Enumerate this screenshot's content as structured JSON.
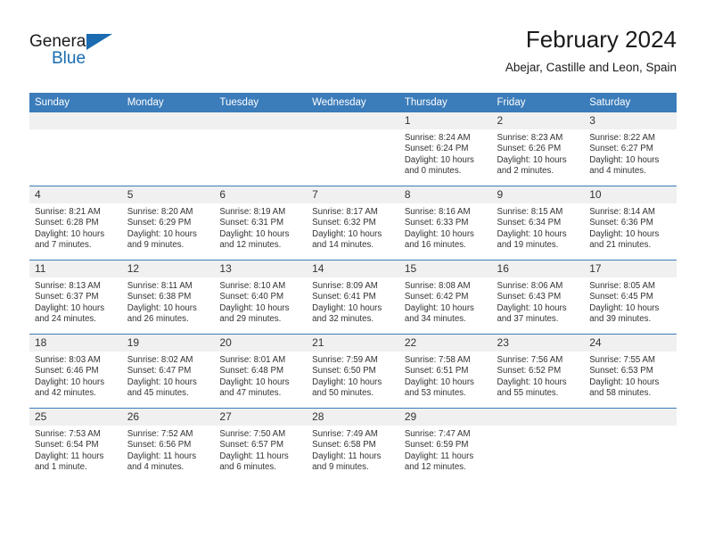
{
  "brand": {
    "name_part1": "General",
    "name_part2": "Blue",
    "triangle_color": "#1a6bb0"
  },
  "header": {
    "title": "February 2024",
    "subtitle": "Abejar, Castille and Leon, Spain"
  },
  "theme": {
    "header_blue": "#3b7cba",
    "daynum_gray": "#f0f0f0",
    "text": "#333333"
  },
  "weekday_headers": [
    "Sunday",
    "Monday",
    "Tuesday",
    "Wednesday",
    "Thursday",
    "Friday",
    "Saturday"
  ],
  "weeks": [
    [
      {
        "day": "",
        "lines": []
      },
      {
        "day": "",
        "lines": []
      },
      {
        "day": "",
        "lines": []
      },
      {
        "day": "",
        "lines": []
      },
      {
        "day": "1",
        "lines": [
          "Sunrise: 8:24 AM",
          "Sunset: 6:24 PM",
          "Daylight: 10 hours and 0 minutes."
        ]
      },
      {
        "day": "2",
        "lines": [
          "Sunrise: 8:23 AM",
          "Sunset: 6:26 PM",
          "Daylight: 10 hours and 2 minutes."
        ]
      },
      {
        "day": "3",
        "lines": [
          "Sunrise: 8:22 AM",
          "Sunset: 6:27 PM",
          "Daylight: 10 hours and 4 minutes."
        ]
      }
    ],
    [
      {
        "day": "4",
        "lines": [
          "Sunrise: 8:21 AM",
          "Sunset: 6:28 PM",
          "Daylight: 10 hours and 7 minutes."
        ]
      },
      {
        "day": "5",
        "lines": [
          "Sunrise: 8:20 AM",
          "Sunset: 6:29 PM",
          "Daylight: 10 hours and 9 minutes."
        ]
      },
      {
        "day": "6",
        "lines": [
          "Sunrise: 8:19 AM",
          "Sunset: 6:31 PM",
          "Daylight: 10 hours and 12 minutes."
        ]
      },
      {
        "day": "7",
        "lines": [
          "Sunrise: 8:17 AM",
          "Sunset: 6:32 PM",
          "Daylight: 10 hours and 14 minutes."
        ]
      },
      {
        "day": "8",
        "lines": [
          "Sunrise: 8:16 AM",
          "Sunset: 6:33 PM",
          "Daylight: 10 hours and 16 minutes."
        ]
      },
      {
        "day": "9",
        "lines": [
          "Sunrise: 8:15 AM",
          "Sunset: 6:34 PM",
          "Daylight: 10 hours and 19 minutes."
        ]
      },
      {
        "day": "10",
        "lines": [
          "Sunrise: 8:14 AM",
          "Sunset: 6:36 PM",
          "Daylight: 10 hours and 21 minutes."
        ]
      }
    ],
    [
      {
        "day": "11",
        "lines": [
          "Sunrise: 8:13 AM",
          "Sunset: 6:37 PM",
          "Daylight: 10 hours and 24 minutes."
        ]
      },
      {
        "day": "12",
        "lines": [
          "Sunrise: 8:11 AM",
          "Sunset: 6:38 PM",
          "Daylight: 10 hours and 26 minutes."
        ]
      },
      {
        "day": "13",
        "lines": [
          "Sunrise: 8:10 AM",
          "Sunset: 6:40 PM",
          "Daylight: 10 hours and 29 minutes."
        ]
      },
      {
        "day": "14",
        "lines": [
          "Sunrise: 8:09 AM",
          "Sunset: 6:41 PM",
          "Daylight: 10 hours and 32 minutes."
        ]
      },
      {
        "day": "15",
        "lines": [
          "Sunrise: 8:08 AM",
          "Sunset: 6:42 PM",
          "Daylight: 10 hours and 34 minutes."
        ]
      },
      {
        "day": "16",
        "lines": [
          "Sunrise: 8:06 AM",
          "Sunset: 6:43 PM",
          "Daylight: 10 hours and 37 minutes."
        ]
      },
      {
        "day": "17",
        "lines": [
          "Sunrise: 8:05 AM",
          "Sunset: 6:45 PM",
          "Daylight: 10 hours and 39 minutes."
        ]
      }
    ],
    [
      {
        "day": "18",
        "lines": [
          "Sunrise: 8:03 AM",
          "Sunset: 6:46 PM",
          "Daylight: 10 hours and 42 minutes."
        ]
      },
      {
        "day": "19",
        "lines": [
          "Sunrise: 8:02 AM",
          "Sunset: 6:47 PM",
          "Daylight: 10 hours and 45 minutes."
        ]
      },
      {
        "day": "20",
        "lines": [
          "Sunrise: 8:01 AM",
          "Sunset: 6:48 PM",
          "Daylight: 10 hours and 47 minutes."
        ]
      },
      {
        "day": "21",
        "lines": [
          "Sunrise: 7:59 AM",
          "Sunset: 6:50 PM",
          "Daylight: 10 hours and 50 minutes."
        ]
      },
      {
        "day": "22",
        "lines": [
          "Sunrise: 7:58 AM",
          "Sunset: 6:51 PM",
          "Daylight: 10 hours and 53 minutes."
        ]
      },
      {
        "day": "23",
        "lines": [
          "Sunrise: 7:56 AM",
          "Sunset: 6:52 PM",
          "Daylight: 10 hours and 55 minutes."
        ]
      },
      {
        "day": "24",
        "lines": [
          "Sunrise: 7:55 AM",
          "Sunset: 6:53 PM",
          "Daylight: 10 hours and 58 minutes."
        ]
      }
    ],
    [
      {
        "day": "25",
        "lines": [
          "Sunrise: 7:53 AM",
          "Sunset: 6:54 PM",
          "Daylight: 11 hours and 1 minute."
        ]
      },
      {
        "day": "26",
        "lines": [
          "Sunrise: 7:52 AM",
          "Sunset: 6:56 PM",
          "Daylight: 11 hours and 4 minutes."
        ]
      },
      {
        "day": "27",
        "lines": [
          "Sunrise: 7:50 AM",
          "Sunset: 6:57 PM",
          "Daylight: 11 hours and 6 minutes."
        ]
      },
      {
        "day": "28",
        "lines": [
          "Sunrise: 7:49 AM",
          "Sunset: 6:58 PM",
          "Daylight: 11 hours and 9 minutes."
        ]
      },
      {
        "day": "29",
        "lines": [
          "Sunrise: 7:47 AM",
          "Sunset: 6:59 PM",
          "Daylight: 11 hours and 12 minutes."
        ]
      },
      {
        "day": "",
        "lines": []
      },
      {
        "day": "",
        "lines": []
      }
    ]
  ]
}
